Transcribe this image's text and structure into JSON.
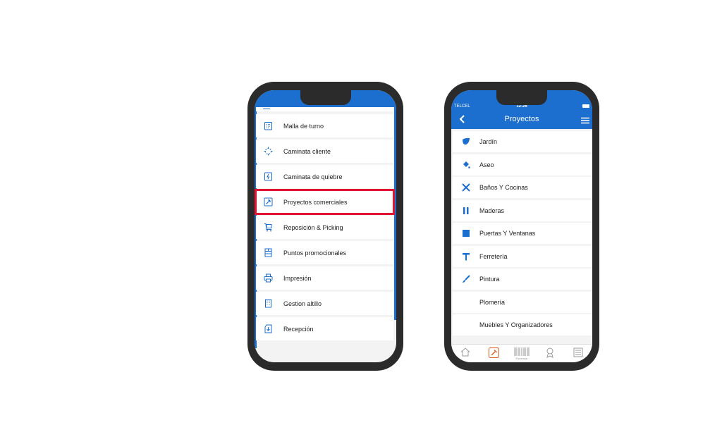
{
  "phone1": {
    "menu": [
      {
        "label": "Malla de turno",
        "icon": "calendar-icon",
        "highlighted": false
      },
      {
        "label": "Caminata cliente",
        "icon": "target-icon",
        "highlighted": false
      },
      {
        "label": "Caminata de quiebre",
        "icon": "bolt-doc-icon",
        "highlighted": false
      },
      {
        "label": "Proyectos comerciales",
        "icon": "hammer-icon",
        "highlighted": true
      },
      {
        "label": "Reposición & Picking",
        "icon": "cart-icon",
        "highlighted": false
      },
      {
        "label": "Puntos promocionales",
        "icon": "shelf-icon",
        "highlighted": false
      },
      {
        "label": "Impresión",
        "icon": "printer-icon",
        "highlighted": false
      },
      {
        "label": "Gestion altillo",
        "icon": "building-icon",
        "highlighted": false
      },
      {
        "label": "Recepción",
        "icon": "receive-doc-icon",
        "highlighted": false
      }
    ]
  },
  "phone2": {
    "status": {
      "carrier": "TELCEL",
      "time": "12:26"
    },
    "title": "Proyectos",
    "categories": [
      {
        "label": "Jardín",
        "icon": "leaf-icon"
      },
      {
        "label": "Aseo",
        "icon": "paint-bucket-icon"
      },
      {
        "label": "Baños Y Cocinas",
        "icon": "utensils-icon"
      },
      {
        "label": "Maderas",
        "icon": "wood-planks-icon"
      },
      {
        "label": "Puertas Y Ventanas",
        "icon": "door-icon"
      },
      {
        "label": "Ferretería",
        "icon": "hammer-icon"
      },
      {
        "label": "Pintura",
        "icon": "brush-icon"
      },
      {
        "label": "Plomería",
        "icon": ""
      },
      {
        "label": "Muebles Y Organizadores",
        "icon": ""
      }
    ],
    "tabs": [
      {
        "icon": "home-icon",
        "label": ""
      },
      {
        "icon": "hammer-icon",
        "label": "",
        "active": true
      },
      {
        "icon": "barcode-icon",
        "label": "Escanear"
      },
      {
        "icon": "award-icon",
        "label": ""
      },
      {
        "icon": "list-icon",
        "label": ""
      }
    ]
  },
  "colors": {
    "accent": "#1c6fcf",
    "highlight": "#e3142f",
    "frame": "#2b2b2b",
    "active_tab": "#e05a1e"
  }
}
